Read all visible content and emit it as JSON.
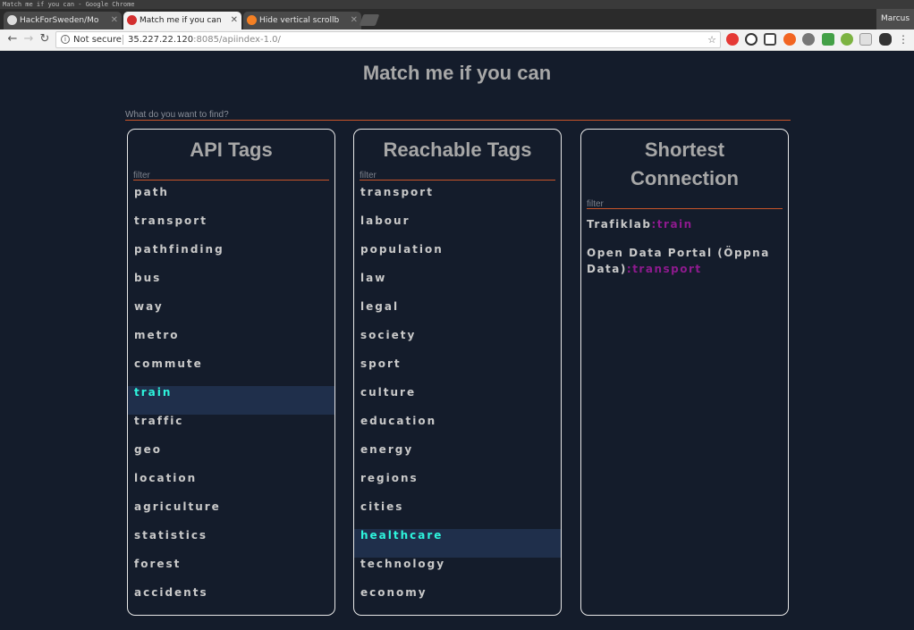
{
  "os": {
    "window_title": "Match me if you can - Google Chrome"
  },
  "browser": {
    "tabs": [
      {
        "label": "HackForSweden/Mo",
        "favicon": "github-icon",
        "active": false
      },
      {
        "label": "Match me if you can",
        "favicon": "angular-icon",
        "active": true
      },
      {
        "label": "Hide vertical scrollb",
        "favicon": "stackoverflow-icon",
        "active": false
      }
    ],
    "profile_name": "Marcus",
    "security_label": "Not secure",
    "url_host": "35.227.22.120",
    "url_rest": ":8085/apiindex-1.0/"
  },
  "app": {
    "title": "Match me if you can",
    "search_placeholder": "What do you want to find?",
    "panels": {
      "api": {
        "title": "API Tags",
        "filter_placeholder": "filter",
        "tags": [
          "path",
          "transport",
          "pathfinding",
          "bus",
          "way",
          "metro",
          "commute",
          "train",
          "traffic",
          "geo",
          "location",
          "agriculture",
          "statistics",
          "forest",
          "accidents"
        ],
        "selected": "train"
      },
      "reachable": {
        "title": "Reachable Tags",
        "filter_placeholder": "filter",
        "tags": [
          "transport",
          "labour",
          "population",
          "law",
          "legal",
          "society",
          "sport",
          "culture",
          "education",
          "energy",
          "regions",
          "cities",
          "healthcare",
          "technology",
          "economy"
        ],
        "selected": "healthcare"
      },
      "shortest": {
        "title_line1": "Shortest",
        "title_line2": "Connection",
        "filter_placeholder": "filter",
        "connections": [
          {
            "source": "Trafiklab",
            "target": ":train"
          },
          {
            "source": "Open Data Portal (Öppna Data)",
            "target": ":transport"
          }
        ]
      }
    }
  },
  "colors": {
    "background": "#141c2b",
    "accent_underline": "#c9542a",
    "selected_row": "#1f2f4b",
    "selected_text": "#2ef5dd",
    "connection_target": "#8e1a8e"
  }
}
